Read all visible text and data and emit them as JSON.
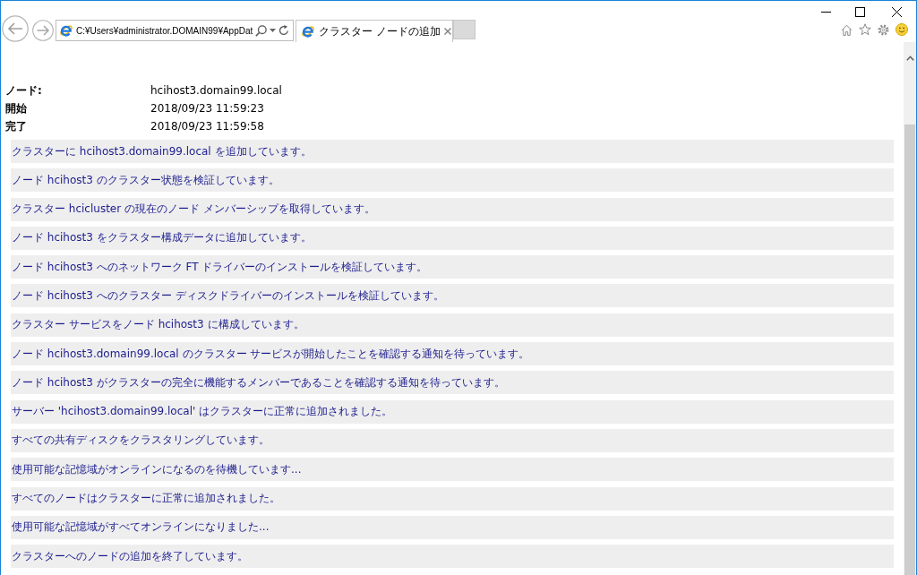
{
  "toolbar": {
    "address": "C:¥Users¥administrator.DOMAIN99¥AppDat",
    "tabs": [
      {
        "title": "クラスター ノードの追加",
        "selected": true
      }
    ]
  },
  "report": {
    "fields": [
      {
        "label": "ノード:",
        "value": "hcihost3.domain99.local"
      },
      {
        "label": "開始",
        "value": "2018/09/23 11:59:23"
      },
      {
        "label": "完了",
        "value": "2018/09/23 11:59:58"
      }
    ],
    "messages": [
      "クラスターに hcihost3.domain99.local を追加しています。",
      "ノード hcihost3 のクラスター状態を検証しています。",
      "クラスター hcicluster の現在のノード メンバーシップを取得しています。",
      "ノード hcihost3 をクラスター構成データに追加しています。",
      "ノード hcihost3 へのネットワーク FT ドライバーのインストールを検証しています。",
      "ノード hcihost3 へのクラスター ディスクドライバーのインストールを検証しています。",
      "クラスター サービスをノード hcihost3 に構成しています。",
      "ノード hcihost3.domain99.local のクラスター サービスが開始したことを確認する通知を待っています。",
      "ノード hcihost3 がクラスターの完全に機能するメンバーであることを確認する通知を待っています。",
      "サーバー 'hcihost3.domain99.local' はクラスターに正常に追加されました。",
      "すべての共有ディスクをクラスタリングしています。",
      "使用可能な記憶域がオンラインになるのを待機しています...",
      "すべてのノードはクラスターに正常に追加されました。",
      "使用可能な記憶域がすべてオンラインになりました...",
      "クラスターへのノードの追加を終了しています。"
    ]
  }
}
